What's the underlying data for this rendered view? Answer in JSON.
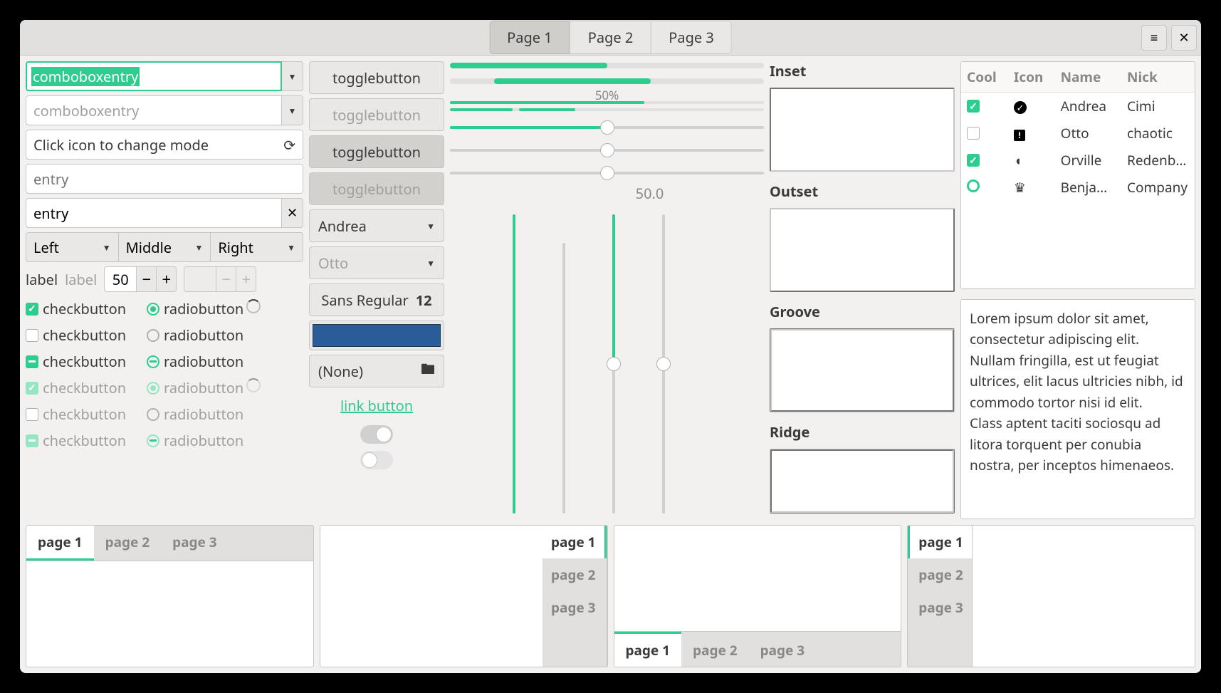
{
  "titlebar": {
    "tabs": [
      "Page 1",
      "Page 2",
      "Page 3"
    ],
    "active_index": 0
  },
  "col1": {
    "combo_entry_focused": "comboboxentry",
    "combo_entry_placeholder": "comboboxentry",
    "mode_entry": "Click icon to change mode",
    "entry_placeholder": "entry",
    "entry_value": "entry",
    "triple": [
      "Left",
      "Middle",
      "Right"
    ],
    "label": "label",
    "label_dis": "label",
    "spin_value": "50",
    "checks": {
      "r1": {
        "check": "checkbutton",
        "radio": "radiobutton"
      },
      "r2": {
        "check": "checkbutton",
        "radio": "radiobutton"
      },
      "r3": {
        "check": "checkbutton",
        "radio": "radiobutton"
      },
      "r4": {
        "check": "checkbutton",
        "radio": "radiobutton"
      },
      "r5": {
        "check": "checkbutton",
        "radio": "radiobutton"
      },
      "r6": {
        "check": "checkbutton",
        "radio": "radiobutton"
      }
    }
  },
  "col2": {
    "toggle1": "togglebutton",
    "toggle2": "togglebutton",
    "toggle3": "togglebutton",
    "toggle4": "togglebutton",
    "combo1": "Andrea",
    "combo2": "Otto",
    "font_name": "Sans Regular",
    "font_size": "12",
    "file_label": "(None)",
    "link": "link button"
  },
  "col3": {
    "progress_text": "50%",
    "scale_label": "50.0"
  },
  "col4": {
    "frames": [
      "Inset",
      "Outset",
      "Groove",
      "Ridge"
    ]
  },
  "col5": {
    "headers": [
      "Cool",
      "Icon",
      "Name",
      "Nick"
    ],
    "rows": [
      {
        "cool": true,
        "icon": "✔",
        "name": "Andrea",
        "nick": "Cimi"
      },
      {
        "cool": false,
        "icon": "!",
        "name": "Otto",
        "nick": "chaotic"
      },
      {
        "cool": true,
        "icon": "◐",
        "name": "Orville",
        "nick": "Redenba..."
      },
      {
        "cool": "ring",
        "icon": "♛",
        "name": "Benja...",
        "nick": "Company"
      }
    ],
    "lorem": "Lorem ipsum dolor sit amet, consectetur adipiscing elit. Nullam fringilla, est ut feugiat ultrices, elit lacus ultricies nibh, id commodo tortor nisi id elit.\nClass aptent taciti sociosqu ad litora torquent per conubia nostra, per inceptos himenaeos."
  },
  "bottom": {
    "tabs": [
      "page 1",
      "page 2",
      "page 3"
    ]
  }
}
